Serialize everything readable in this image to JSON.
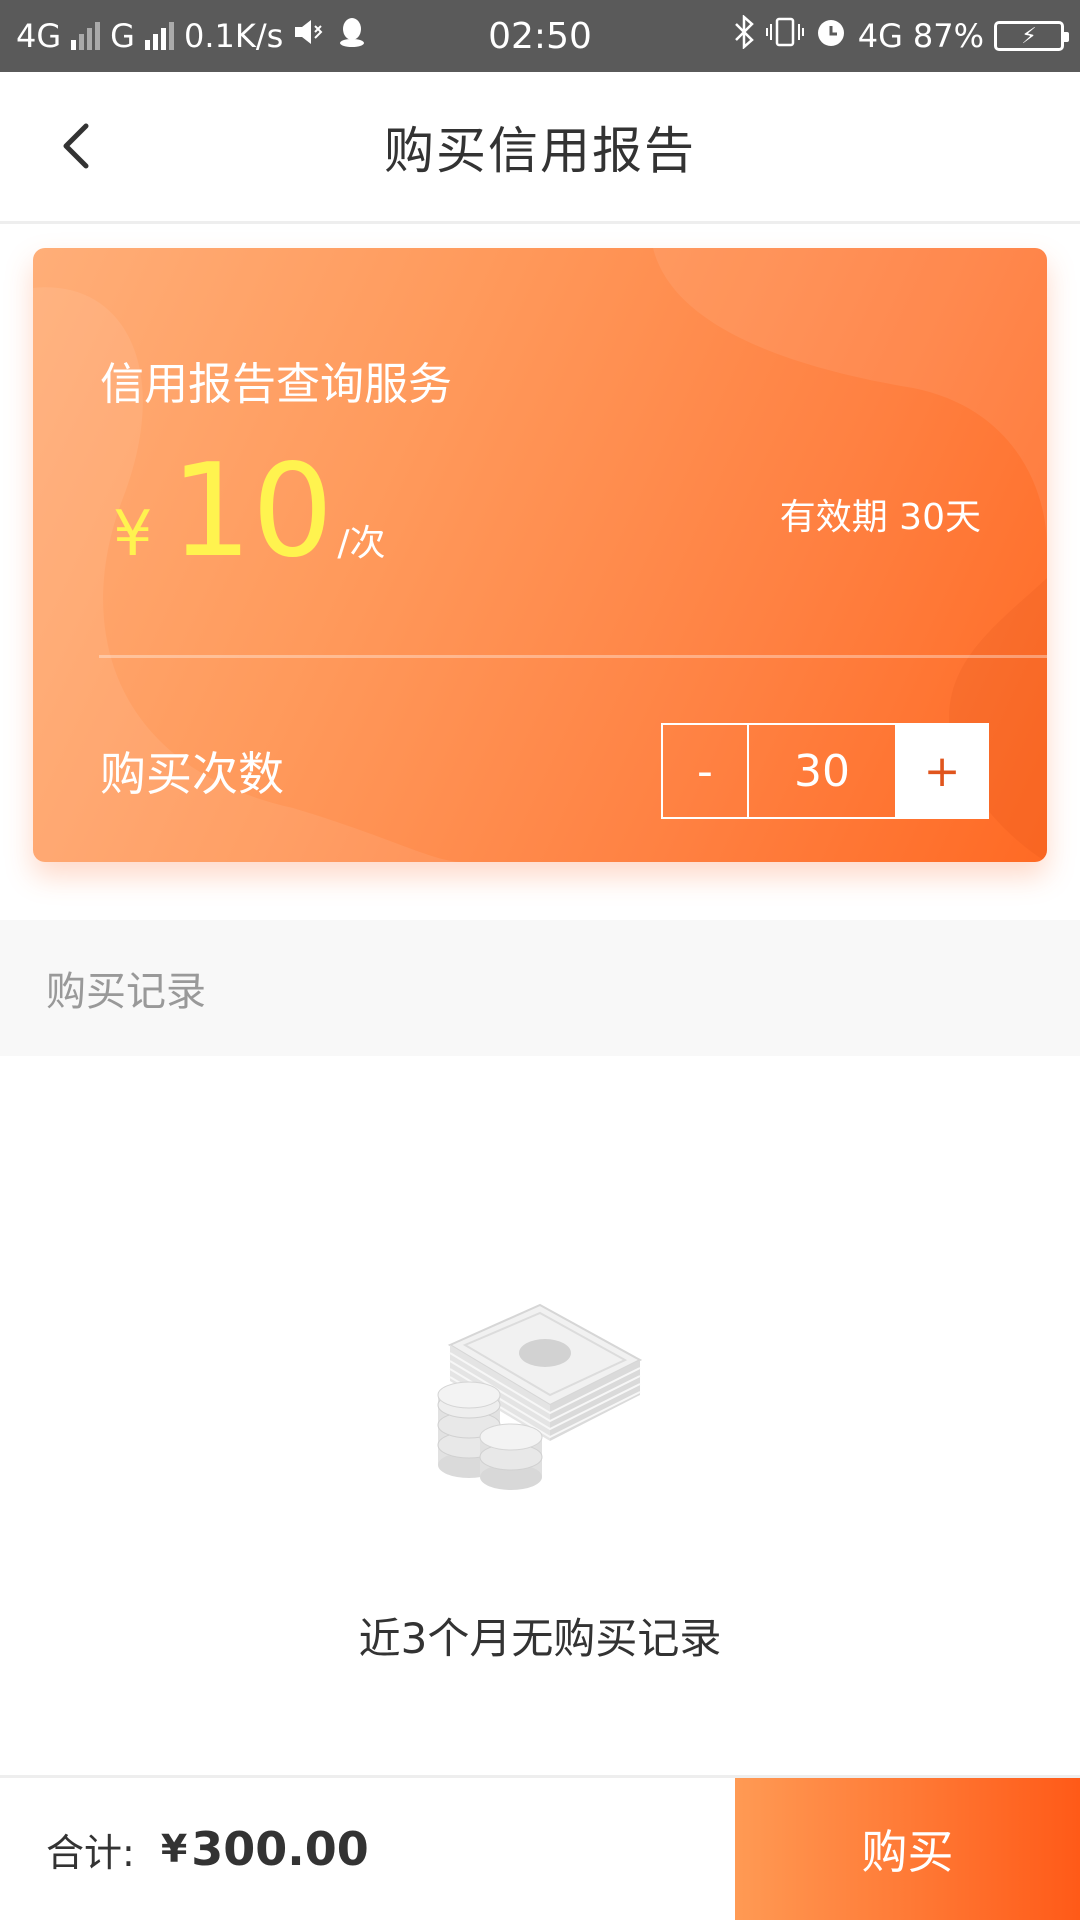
{
  "status_bar": {
    "left_network1": "4G",
    "left_network2": "G",
    "speed": "0.1K/s",
    "time": "02:50",
    "net_right": "4G",
    "battery_percent": "87%",
    "icons": [
      "signal-icon",
      "volume-icon",
      "qq-icon",
      "bluetooth-icon",
      "vibrate-icon",
      "alarm-icon",
      "battery-icon"
    ]
  },
  "header": {
    "title": "购买信用报告",
    "back_icon": "chevron-left-icon"
  },
  "card": {
    "title": "信用报告查询服务",
    "currency": "¥",
    "price": "10",
    "unit": "/次",
    "validity": "有效期 30天",
    "qty_label": "购买次数",
    "minus": "-",
    "qty_value": "30",
    "plus": "+",
    "colors": {
      "price": "#fff34f",
      "gradient_start": "#ffae78",
      "gradient_end": "#ff6a24"
    }
  },
  "records": {
    "title": "购买记录",
    "empty_text": "近3个月无购买记录",
    "illustration": "money-stack-icon"
  },
  "bottom": {
    "total_label": "合计:",
    "currency": "¥",
    "total_amount": "300.00",
    "buy_label": "购买"
  }
}
